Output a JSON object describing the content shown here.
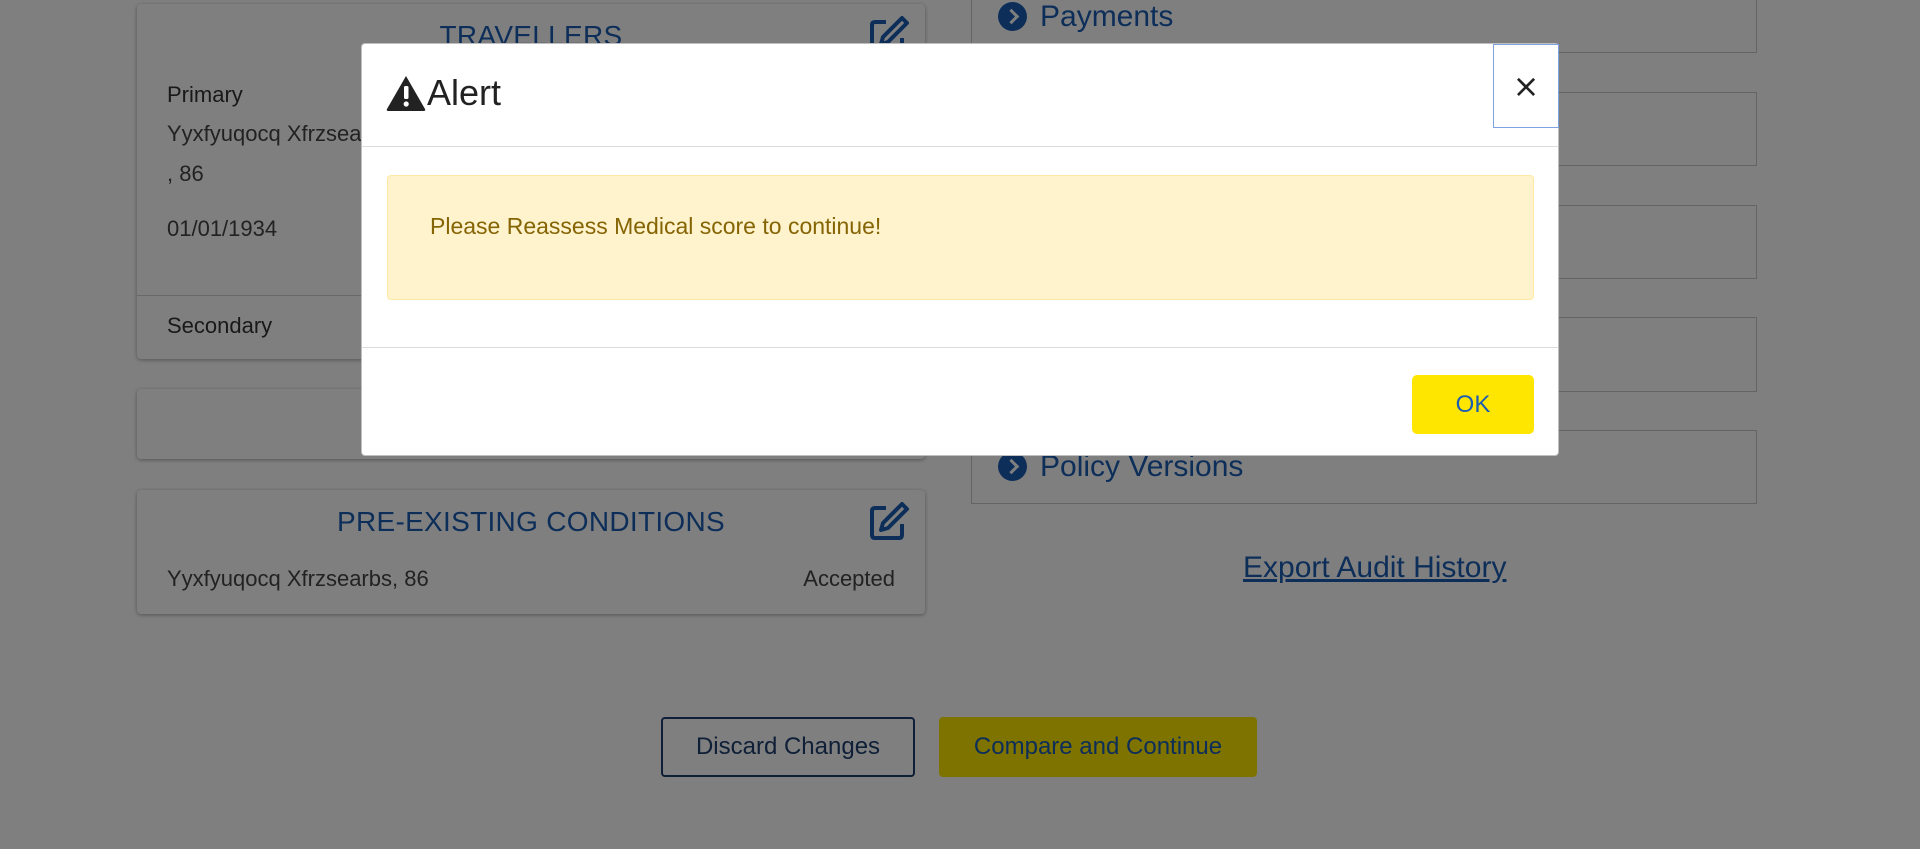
{
  "travellers": {
    "title": "TRAVELLERS",
    "primary_label": "Primary",
    "primary_name": "Yyxfyuqocq Xfrzsearbs",
    "primary_age": ", 86",
    "primary_dob": "01/01/1934",
    "secondary_label": "Secondary"
  },
  "conditions": {
    "title": "PRE-EXISTING CONDITIONS",
    "person": "Yyxfyuqocq Xfrzsearbs, 86",
    "status": "Accepted"
  },
  "accordions": [
    {
      "label": "Payments",
      "icon": "chevron-circle-right-icon"
    },
    {
      "label": "",
      "icon": "chevron-circle-right-icon"
    },
    {
      "label": "",
      "icon": "chevron-circle-right-icon"
    },
    {
      "label": "",
      "icon": "chevron-circle-right-icon"
    },
    {
      "label": "Policy Versions",
      "icon": "chevron-circle-right-icon"
    }
  ],
  "export_link": "Export Audit History",
  "actions": {
    "discard": "Discard Changes",
    "compare": "Compare and Continue"
  },
  "modal": {
    "title": "Alert",
    "icon": "warning-icon",
    "close_symbol": "×",
    "message": "Please Reassess Medical score to continue!",
    "ok": "OK"
  },
  "colors": {
    "brand_blue": "#1a5db3",
    "accent_yellow": "#ffe600",
    "warning_bg": "#fff3cd",
    "warning_text": "#856404",
    "backdrop": "rgba(0,0,0,0.5)"
  }
}
